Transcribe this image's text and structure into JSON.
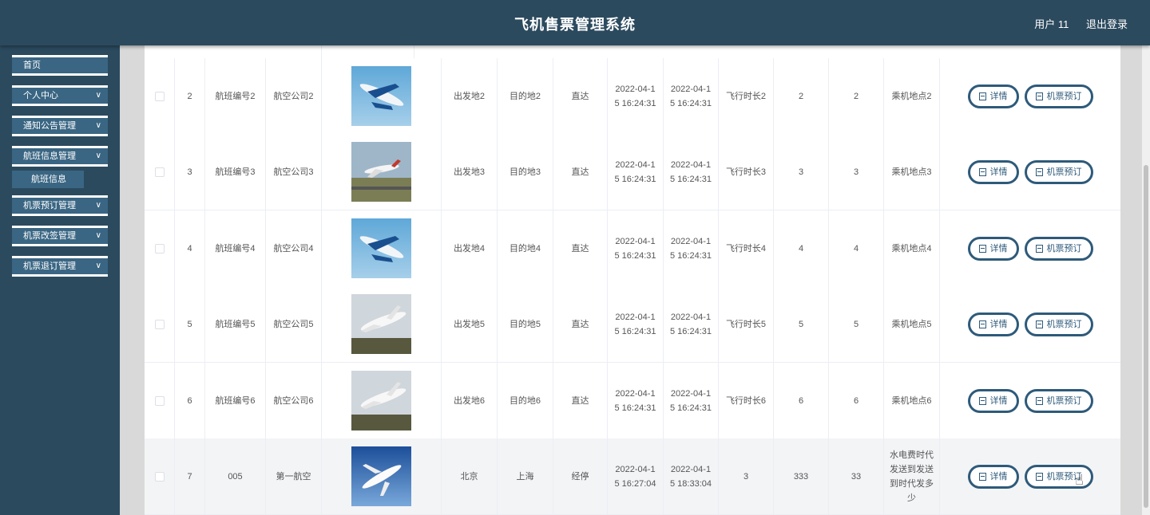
{
  "header": {
    "title": "飞机售票管理系统",
    "user": "用户 11",
    "logout": "退出登录"
  },
  "sidebar": {
    "items": [
      {
        "label": "首页",
        "has_chevron": false
      },
      {
        "label": "个人中心",
        "has_chevron": true
      },
      {
        "label": "通知公告管理",
        "has_chevron": true
      },
      {
        "label": "航班信息管理",
        "has_chevron": true
      },
      {
        "label": "机票预订管理",
        "has_chevron": true
      },
      {
        "label": "机票改签管理",
        "has_chevron": true
      },
      {
        "label": "机票退订管理",
        "has_chevron": true
      }
    ],
    "submenu": {
      "label": "航班信息"
    },
    "chevron_icon": "chevron-down-icon"
  },
  "table": {
    "actions": {
      "detail": "详情",
      "book": "机票预订"
    },
    "rows": [
      {
        "idx": "2",
        "flight_no": "航班编号2",
        "airline": "航空公司2",
        "image": "blue-jet",
        "from": "出发地2",
        "to": "目的地2",
        "type": "直达",
        "depart": "2022-04-15 16:24:31",
        "arrive": "2022-04-15 16:24:31",
        "duration": "飞行时长2",
        "c1": "2",
        "c2": "2",
        "boarding": "乘机地点2"
      },
      {
        "idx": "3",
        "flight_no": "航班编号3",
        "airline": "航空公司3",
        "image": "runway-jet",
        "from": "出发地3",
        "to": "目的地3",
        "type": "直达",
        "depart": "2022-04-15 16:24:31",
        "arrive": "2022-04-15 16:24:31",
        "duration": "飞行时长3",
        "c1": "3",
        "c2": "3",
        "boarding": "乘机地点3"
      },
      {
        "idx": "4",
        "flight_no": "航班编号4",
        "airline": "航空公司4",
        "image": "blue-jet",
        "from": "出发地4",
        "to": "目的地4",
        "type": "直达",
        "depart": "2022-04-15 16:24:31",
        "arrive": "2022-04-15 16:24:31",
        "duration": "飞行时长4",
        "c1": "4",
        "c2": "4",
        "boarding": "乘机地点4"
      },
      {
        "idx": "5",
        "flight_no": "航班编号5",
        "airline": "航空公司5",
        "image": "white-jet",
        "from": "出发地5",
        "to": "目的地5",
        "type": "直达",
        "depart": "2022-04-15 16:24:31",
        "arrive": "2022-04-15 16:24:31",
        "duration": "飞行时长5",
        "c1": "5",
        "c2": "5",
        "boarding": "乘机地点5"
      },
      {
        "idx": "6",
        "flight_no": "航班编号6",
        "airline": "航空公司6",
        "image": "white-jet",
        "from": "出发地6",
        "to": "目的地6",
        "type": "直达",
        "depart": "2022-04-15 16:24:31",
        "arrive": "2022-04-15 16:24:31",
        "duration": "飞行时长6",
        "c1": "6",
        "c2": "6",
        "boarding": "乘机地点6"
      },
      {
        "idx": "7",
        "flight_no": "005",
        "airline": "第一航空",
        "image": "sky-jet",
        "from": "北京",
        "to": "上海",
        "type": "经停",
        "depart": "2022-04-15 16:27:04",
        "arrive": "2022-04-15 18:33:04",
        "duration": "3",
        "c1": "333",
        "c2": "33",
        "boarding": "水电费时代发送到发送到时代发多少"
      }
    ]
  }
}
